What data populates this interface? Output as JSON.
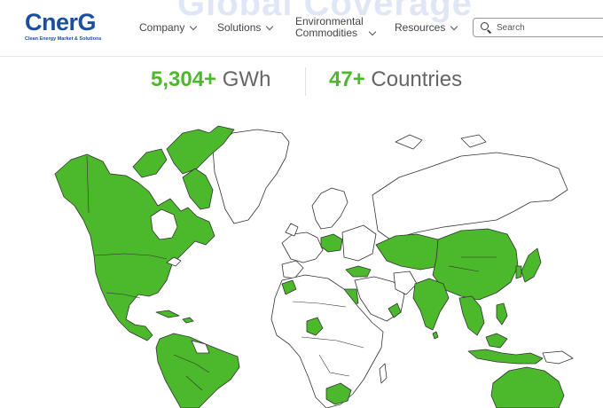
{
  "header": {
    "logo_text": "CnerG",
    "logo_tagline": "Clean Energy Market & Solutions",
    "background_title": "Global Coverage",
    "nav": [
      {
        "label": "Company"
      },
      {
        "label": "Solutions"
      },
      {
        "label": "Environmental\nCommodities"
      },
      {
        "label": "Resources"
      }
    ],
    "search": {
      "placeholder": "Search"
    }
  },
  "stats": {
    "energy": {
      "value": "5,304+",
      "unit": "GWh"
    },
    "countries": {
      "value": "47+",
      "unit": "Countries"
    }
  },
  "colors": {
    "brand_blue": "#1a4fa0",
    "accent_green": "#4cb82b",
    "map_unselected": "#ffffff",
    "map_outline": "#333333"
  },
  "map": {
    "icon": "world-map",
    "highlighted_regions": [
      "North America",
      "Central America",
      "South America",
      "Western Europe",
      "Eastern Europe",
      "Middle East",
      "South Asia",
      "East Asia",
      "Southeast Asia",
      "Oceania",
      "Southern Africa",
      "West Africa"
    ]
  }
}
